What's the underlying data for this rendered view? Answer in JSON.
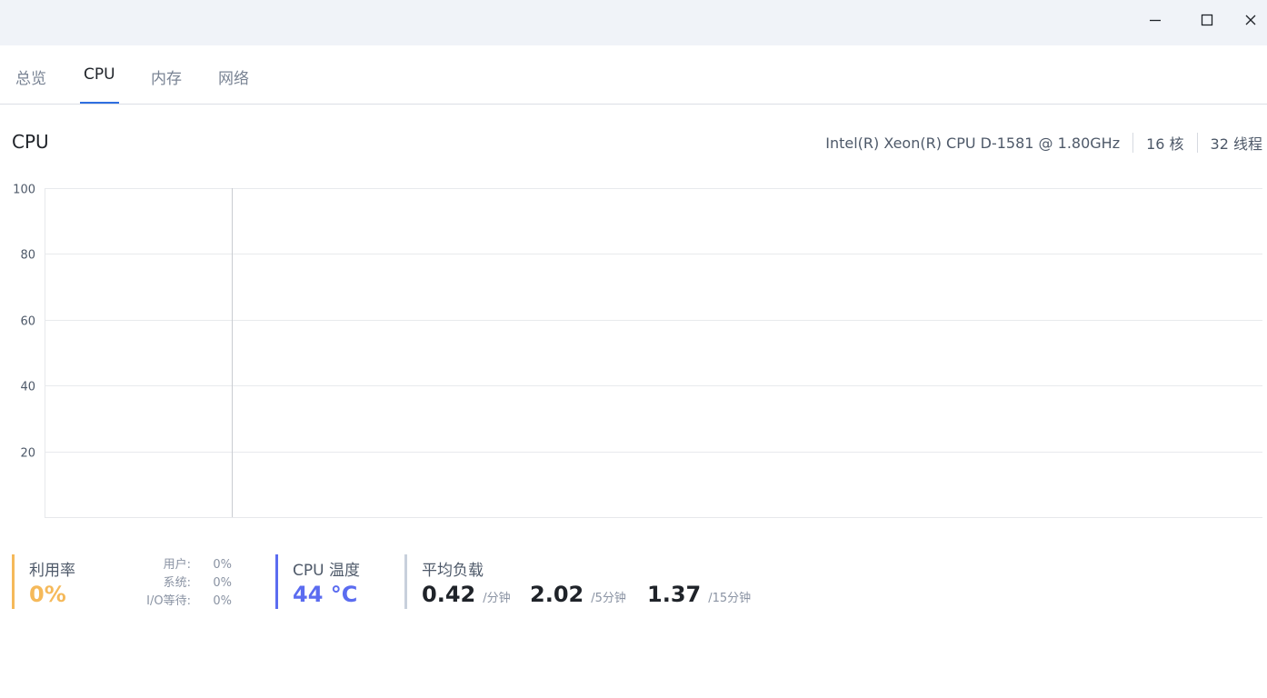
{
  "window": {
    "controls": [
      "minimize-icon",
      "maximize-icon",
      "close-icon"
    ]
  },
  "tabs": [
    {
      "label": "总览",
      "active": false
    },
    {
      "label": "CPU",
      "active": true
    },
    {
      "label": "内存",
      "active": false
    },
    {
      "label": "网络",
      "active": false
    }
  ],
  "header": {
    "title": "CPU",
    "model": "Intel(R) Xeon(R) CPU D-1581 @ 1.80GHz",
    "cores": "16 核",
    "threads": "32 线程"
  },
  "chart_data": {
    "type": "line",
    "title": "",
    "xlabel": "",
    "ylabel": "",
    "ylim": [
      0,
      100
    ],
    "yticks": [
      20,
      40,
      60,
      80,
      100
    ],
    "grid": true,
    "series": [],
    "cursor_fraction": 0.154
  },
  "stats": {
    "utilization": {
      "label": "利用率",
      "value": "0%",
      "breakdown": [
        {
          "key": "用户:",
          "value": "0%"
        },
        {
          "key": "系统:",
          "value": "0%"
        },
        {
          "key": "I/O等待:",
          "value": "0%"
        }
      ]
    },
    "temperature": {
      "label": "CPU 温度",
      "value": "44 °C"
    },
    "load": {
      "label": "平均负载",
      "items": [
        {
          "value": "0.42",
          "unit": "/分钟"
        },
        {
          "value": "2.02",
          "unit": "/5分钟"
        },
        {
          "value": "1.37",
          "unit": "/15分钟"
        }
      ]
    }
  },
  "colors": {
    "accent_tab": "#2f6fe0",
    "utilization": "#f5b95a",
    "temperature": "#5b6cf0",
    "load_bar": "#c8d0dc",
    "titlebar_bg": "#f0f3f8"
  }
}
